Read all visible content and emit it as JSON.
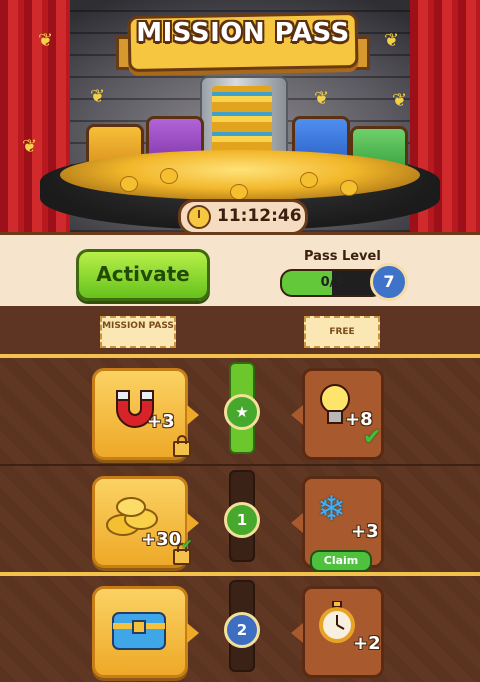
{
  "header": {
    "title": "MISSION PASS",
    "timer": "11:12:46",
    "timer_icon": "clock-icon"
  },
  "top_bar": {
    "activate_label": "Activate",
    "pass_level_label": "Pass Level",
    "progress_text": "0/3",
    "progress_fraction": 0.5,
    "level": "7"
  },
  "columns": {
    "mission_pass_label": "MISSION PASS",
    "free_label": "FREE"
  },
  "rows": [
    {
      "node": "★",
      "node_icon": "star-icon",
      "node_state": "completed",
      "pass_reward": {
        "icon": "magnet-icon",
        "amount": "+3",
        "locked": true,
        "checked": false
      },
      "free_reward": {
        "icon": "lightbulb-icon",
        "amount": "+8",
        "claimed": true
      }
    },
    {
      "node": "1",
      "node_state": "available",
      "pass_reward": {
        "icon": "coins-icon",
        "amount": "+30",
        "locked": true,
        "checked": true
      },
      "free_reward": {
        "icon": "snowflake-icon",
        "amount": "+3",
        "claim_label": "Claim"
      }
    },
    {
      "node": "2",
      "node_state": "locked",
      "pass_reward": {
        "icon": "chest-icon",
        "amount": ""
      },
      "free_reward": {
        "icon": "stopwatch-icon",
        "amount": "+2"
      }
    }
  ],
  "colors": {
    "accent_green": "#66c21c",
    "gold": "#f2c24c",
    "wood": "#5d3522",
    "level_blue": "#3f73c9"
  }
}
